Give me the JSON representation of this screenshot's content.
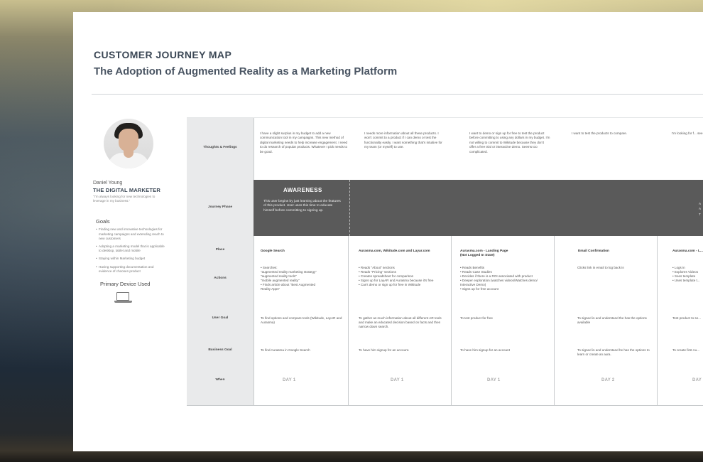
{
  "header": {
    "title": "CUSTOMER JOURNEY MAP",
    "subtitle": "The Adoption of Augmented Reality as a Marketing Platform"
  },
  "persona": {
    "name": "Daniel Young",
    "role": "THE DIGITAL MARKETER",
    "quote": "\"I'm always looking for new technologies to leverage in my business.\"",
    "goals_heading": "Goals",
    "goals": [
      "Finding new and innovative technologies for marketing campaigns and extending reach to new customers",
      "Adopting a marketing model that is applicable to desktop, tablet and mobile",
      "Staying within Marketing budget",
      "Having supporting documentation and evidence of choosen product"
    ],
    "device_heading": "Primary Device Used",
    "device_icon": "laptop-icon"
  },
  "rows": {
    "thoughts": "Thoughts & Feelings",
    "phase": "Journey Phase",
    "place": "Place",
    "actions": "Actions",
    "user_goal": "User Goal",
    "business_goal": "Business Goal",
    "when": "When"
  },
  "thoughts": [
    "I have a slight surplus in my budget to add a new communication tool in my campaigns. This new method of digital marketing needs to help increase engagement. I need to do research of popular products. Whatever I pick needs to be good.",
    "I needs more information about all these products. I won't commit to a product if I can demo or test the functionality easily. I want something that's intuitive for my team (or myself) to use.",
    "I want to demo or sign up for free to test the product before committing to using any dollars in my budget. I'm not willing to commit to Wikitude because they don't offer a free trial or interactive demo. Seems too complicated.",
    "I want to test the products to compare.",
    "I'm looking for f... see which one is b..."
  ],
  "phase": {
    "title": "AWARENESS",
    "description": "This user begins by just learning about the features of this product. User uses this time to educate himself before committing to signing up.",
    "edge_text": "A\nA\nT"
  },
  "columns": [
    {
      "place": "Google Search",
      "actions": [
        "• Searches:",
        "\"augmented reality marketing strategy\"",
        "\"augmented reality tools\"",
        "\"mobile augmented reality\"",
        "• Finds article about \"Best Augmented",
        "Reality Apps\""
      ],
      "user_goal": "To find options and compare tools (Wikitude, LayAR and Aurasma)",
      "business_goal": "To find Aurasma in Google Search",
      "when": "DAY 1"
    },
    {
      "place": "Aurasma.com, Wikitude.com and Layar.com",
      "actions": [
        "• Reads \"About\" sections",
        "• Reads \"Pricing\" sections",
        "• Creates spreadsheet for comparison",
        "• Signs up for LayAR and Aurasma because it's free",
        "• Can't demo or sign up for free in Wikitude"
      ],
      "user_goal": "To gather as much information about all different AR tools and make an educated decision based on facts and then narrow down search.",
      "business_goal": "To have him signup for an account.",
      "when": "DAY 1"
    },
    {
      "place": "Aurasma.com - Landing Page\n(Not Logged In State)",
      "actions": [
        "• Reads Benefits",
        "• Reads Case Studies",
        "• Decides if there is a ROI associated with product",
        "• Deeper exploration (watches videos/Watches demo/",
        "Interactive Demo)",
        "• Signs up for free account"
      ],
      "user_goal": "To test product for free",
      "business_goal": "To have him signup for an account",
      "when": "DAY 1"
    },
    {
      "place": "Email Confirmation",
      "actions": [
        "Clicks link in email to log back in"
      ],
      "user_goal": "To signed in and understand the has the options available",
      "business_goal": "To signed in and understand he has the options to learn or create an aura.",
      "when": "DAY 2"
    },
    {
      "place": "Aurasma.com - L...",
      "actions": [
        "• Logs in",
        "• Explores Videos",
        "• Sees template",
        "• Uses template t..."
      ],
      "user_goal": "Test product to se...",
      "business_goal": "To create first Au...",
      "when": "DAY"
    }
  ],
  "colors": {
    "title": "#3c4856",
    "label_column": "#e9eaeb",
    "phase_bar": "#5a5a5a"
  }
}
